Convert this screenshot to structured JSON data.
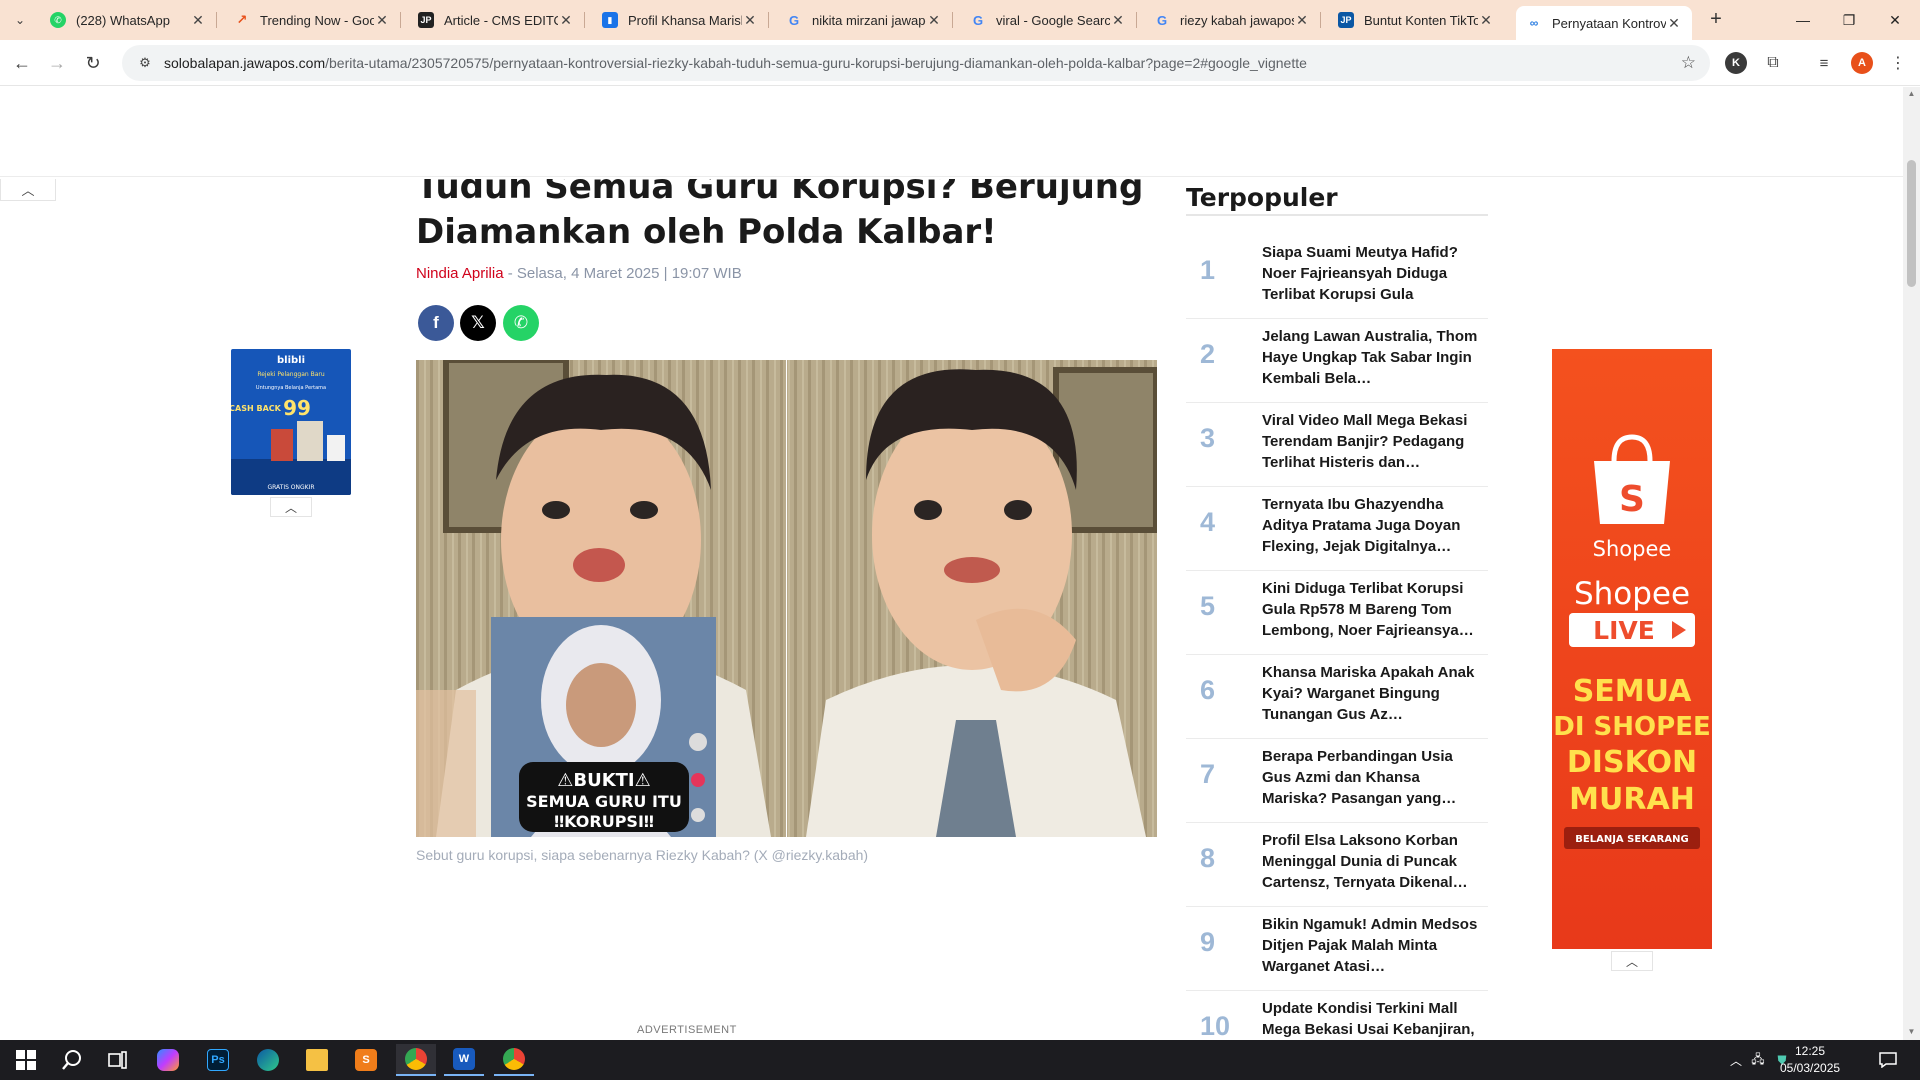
{
  "browser": {
    "tabs": [
      {
        "title": "(228) WhatsApp",
        "favicon": "whatsapp-icon",
        "color": "#25d366"
      },
      {
        "title": "Trending Now - Google",
        "favicon": "trends-icon",
        "color": "#e8501a"
      },
      {
        "title": "Article - CMS EDITOR",
        "favicon": "cms-icon",
        "color": "#222222"
      },
      {
        "title": "Profil Khansa Mariska",
        "favicon": "doc-icon",
        "color": "#1a73e8"
      },
      {
        "title": "nikita mirzani jawapos",
        "favicon": "google-icon",
        "color": "#4285f4"
      },
      {
        "title": "viral - Google Search",
        "favicon": "google-icon",
        "color": "#4285f4"
      },
      {
        "title": "riezy kabah jawapos",
        "favicon": "google-icon",
        "color": "#4285f4"
      },
      {
        "title": "Buntut Konten TikTok",
        "favicon": "jp-icon",
        "color": "#0b57a4"
      },
      {
        "title": "Pernyataan Kontroversial",
        "favicon": "jawapos-icon",
        "color": "#2a7de1"
      }
    ],
    "url_domain": "solobalapan.jawapos.com",
    "url_path": "/berita-utama/2305720575/pernyataan-kontroversial-riezky-kabah-tuduh-semua-guru-korupsi-berujung-diamankan-oleh-polda-kalbar?page=2#google_vignette",
    "profile_initial_k": "K",
    "profile_initial_a": "A"
  },
  "article": {
    "headline": "Tuduh Semua Guru Korupsi? Berujung Diamankan oleh Polda Kalbar!",
    "author": "Nindia Aprilia",
    "date": " - Selasa, 4 Maret 2025 | 19:07 WIB",
    "image_overlay_line1": "⚠BUKTI⚠",
    "image_overlay_line2": "SEMUA GURU ITU",
    "image_overlay_line3": "‼KORUPSI‼",
    "caption": "Sebut guru korupsi, siapa sebenarnya Riezky Kabah? (X @riezky.kabah)",
    "ad_label": "ADVERTISEMENT"
  },
  "sidebar": {
    "title": "Terpopuler",
    "items": [
      {
        "num": "1",
        "text": "Siapa Suami Meutya Hafid? Noer Fajrieansyah Diduga Terlibat Korupsi Gula Senilai…"
      },
      {
        "num": "2",
        "text": "Jelang Lawan Australia, Thom Haye Ungkap Tak Sabar Ingin Kembali Bela…"
      },
      {
        "num": "3",
        "text": "Viral Video Mall Mega Bekasi Terendam Banjir? Pedagang Terlihat Histeris dan…"
      },
      {
        "num": "4",
        "text": "Ternyata Ibu Ghazyendha Aditya Pratama Juga Doyan Flexing, Jejak Digitalnya…"
      },
      {
        "num": "5",
        "text": "Kini Diduga Terlibat Korupsi Gula Rp578 M Bareng Tom Lembong, Noer Fajrieansya…"
      },
      {
        "num": "6",
        "text": "Khansa Mariska Apakah Anak Kyai? Warganet Bingung Tunangan Gus Az…"
      },
      {
        "num": "7",
        "text": "Berapa Perbandingan Usia Gus Azmi dan Khansa Mariska? Pasangan yang…"
      },
      {
        "num": "8",
        "text": "Profil Elsa Laksono Korban Meninggal Dunia di Puncak Cartensz, Ternyata Dikenal…"
      },
      {
        "num": "9",
        "text": "Bikin Ngamuk! Admin Medsos Ditjen Pajak Malah Minta Warganet Atasi…"
      },
      {
        "num": "10",
        "text": "Update Kondisi Terkini Mall Mega Bekasi Usai Kebanjiran,"
      }
    ]
  },
  "left_ad": {
    "brand": "blibli",
    "tagline": "Rejeki Pelanggan Baru",
    "subline": "Untungnya Belanja Pertama",
    "cashback_label": "CASH BACK",
    "cashback_value": "99",
    "footer": "GRATIS ONGKIR"
  },
  "right_ad": {
    "brand": "Shopee",
    "brand_big": "Shopee",
    "live": "LIVE",
    "line1": "SEMUA",
    "line2": "DI SHOPEE",
    "line3": "DISKON",
    "line4": "MURAH",
    "cta": "BELANJA SEKARANG"
  },
  "taskbar": {
    "time": "12:25",
    "date": "05/03/2025"
  }
}
